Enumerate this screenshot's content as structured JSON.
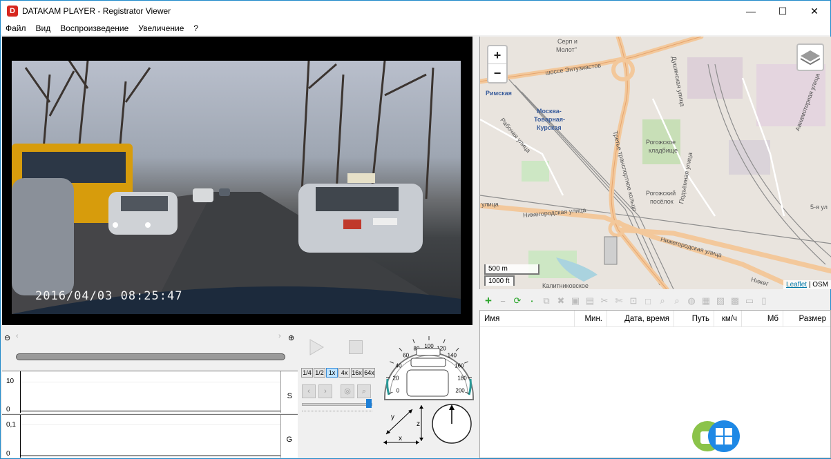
{
  "window": {
    "app_icon_letter": "D",
    "title": "DATAKAM PLAYER - Registrator Viewer",
    "minimize": "—",
    "maximize": "☐",
    "close": "✕"
  },
  "menu": [
    "Файл",
    "Вид",
    "Воспроизведение",
    "Увеличение",
    "?"
  ],
  "video": {
    "timestamp": "2016/04/03  08:25:47"
  },
  "graphs": {
    "speed": {
      "ymax": "10",
      "ymin": "0",
      "letter": "S"
    },
    "g": {
      "ymax": "0,1",
      "ymin": "0",
      "letter": "G"
    }
  },
  "controls": {
    "speeds": [
      "1/4",
      "1/2",
      "1x",
      "4x",
      "16x",
      "64x"
    ],
    "active_speed": "1x",
    "speedometer_ticks": [
      "0",
      "20",
      "40",
      "60",
      "80",
      "100",
      "120",
      "140",
      "160",
      "180",
      "200"
    ],
    "accel_axes": {
      "x": "x",
      "y": "y",
      "z": "z"
    }
  },
  "map": {
    "zoom_in": "+",
    "zoom_out": "−",
    "scale_metric": "500 m",
    "scale_imperial": "1000 ft",
    "attribution_leaflet": "Leaflet",
    "attribution_sep": " | ",
    "attribution_osm": "OSM",
    "labels": {
      "serp": "Серп и",
      "molot": "Молот\"",
      "entuziastov": "шоссе Энтузиастов",
      "rimskaya": "Римская",
      "moskva1": "Москва-",
      "moskva2": "Товарная-",
      "moskva3": "Курская",
      "rabochaya": "Рабочая улица",
      "rogozh1": "Рогожское",
      "rogozh2": "кладбище",
      "rogozh3": "Рогожский",
      "rogozh4": "посёлок",
      "dushinskaya": "Душинская улица",
      "aviamotornaya": "Авиамоторная улица",
      "podemnaya": "Подъёмная улица",
      "nizhegor1": "Нижегородская улица",
      "nizhegor2": "Нижегородская улица",
      "ulica": "улица",
      "tretye": "Третье транспортное кольцо",
      "kalitnikovskoe": "Калитниковское",
      "fifth": "5-я ул",
      "nizh_short": "Нижег"
    }
  },
  "tracklist": {
    "columns": [
      "Имя",
      "Мин.",
      "Дата, время",
      "Путь",
      "км/ч",
      "Мб",
      "Размер"
    ]
  }
}
